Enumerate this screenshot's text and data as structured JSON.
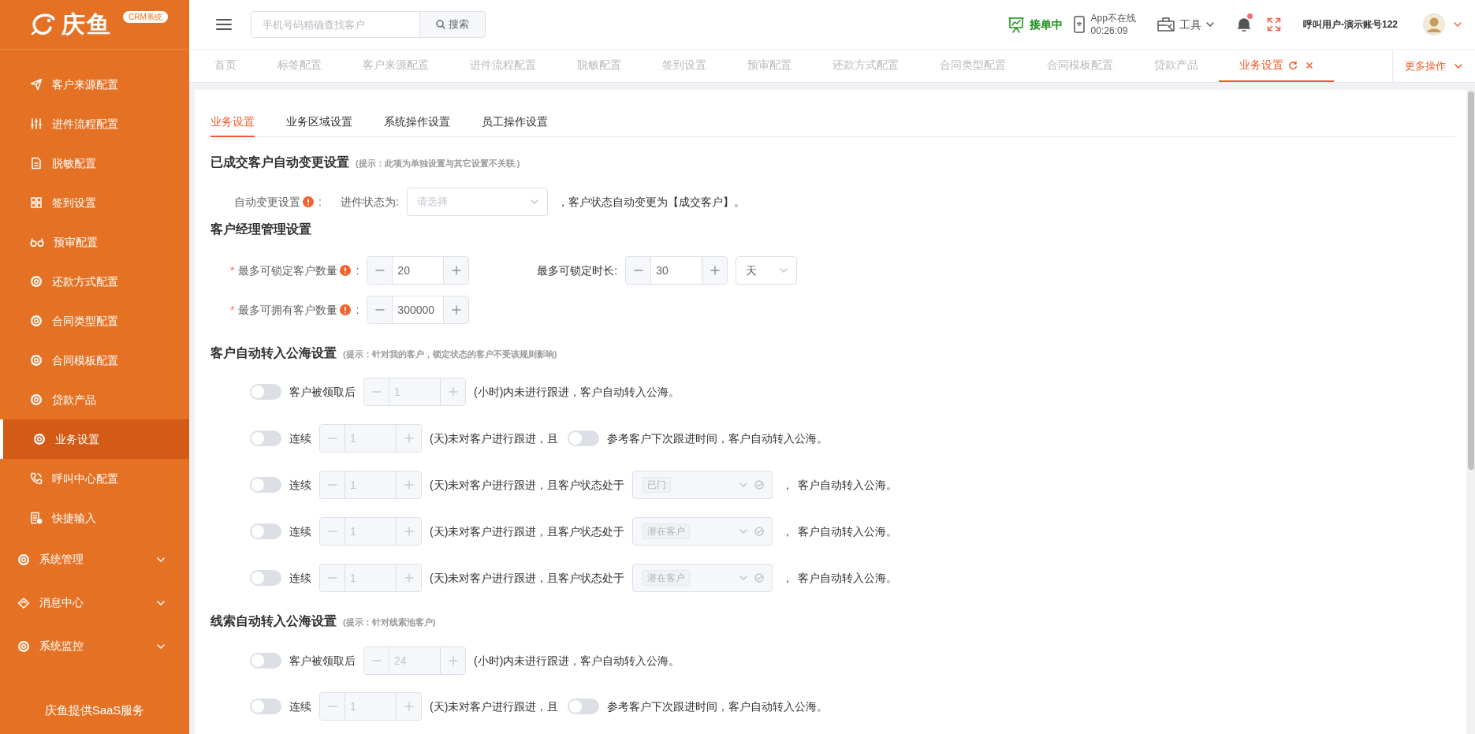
{
  "logo": {
    "name": "庆鱼",
    "badge": "CRM系统"
  },
  "sidebar": {
    "items": [
      {
        "label": "客户来源配置",
        "selected": false
      },
      {
        "label": "进件流程配置",
        "selected": false
      },
      {
        "label": "脱敏配置",
        "selected": false
      },
      {
        "label": "签到设置",
        "selected": false
      },
      {
        "label": "预审配置",
        "selected": false
      },
      {
        "label": "还款方式配置",
        "selected": false
      },
      {
        "label": "合同类型配置",
        "selected": false
      },
      {
        "label": "合同模板配置",
        "selected": false
      },
      {
        "label": "贷款产品",
        "selected": false
      },
      {
        "label": "业务设置",
        "selected": true
      },
      {
        "label": "呼叫中心配置",
        "selected": false
      },
      {
        "label": "快捷输入",
        "selected": false
      }
    ],
    "groups": [
      {
        "label": "系统管理",
        "expanded": false
      },
      {
        "label": "消息中心",
        "expanded": false
      },
      {
        "label": "系统监控",
        "expanded": false
      }
    ],
    "footer": "庆鱼提供SaaS服务"
  },
  "header": {
    "search": {
      "placeholder": "手机号码精确查找客户",
      "button": "搜索"
    },
    "order_status": "接单中",
    "app_status": {
      "label": "App不在线",
      "time": "00:26:09"
    },
    "tools": "工具",
    "notification_dot": true,
    "user": "呼叫用户-演示账号122"
  },
  "page_tabs": {
    "items": [
      {
        "label": "首页",
        "selected": false
      },
      {
        "label": "标签配置",
        "selected": false
      },
      {
        "label": "客户来源配置",
        "selected": false
      },
      {
        "label": "进件流程配置",
        "selected": false
      },
      {
        "label": "脱敏配置",
        "selected": false
      },
      {
        "label": "签到设置",
        "selected": false
      },
      {
        "label": "预审配置",
        "selected": false
      },
      {
        "label": "还款方式配置",
        "selected": false
      },
      {
        "label": "合同类型配置",
        "selected": false
      },
      {
        "label": "合同模板配置",
        "selected": false
      },
      {
        "label": "贷款产品",
        "selected": false
      },
      {
        "label": "业务设置",
        "selected": true
      }
    ],
    "more": "更多操作"
  },
  "sub_tabs": [
    {
      "label": "业务设置",
      "selected": true
    },
    {
      "label": "业务区域设置",
      "selected": false
    },
    {
      "label": "系统操作设置",
      "selected": false
    },
    {
      "label": "员工操作设置",
      "selected": false
    }
  ],
  "sections": [
    {
      "title": "已成交客户自动变更设置",
      "hint": "(提示：此项为单独设置与其它设置不关联.)",
      "kind": "form",
      "rows": [
        {
          "parts": [
            {
              "kind": "label",
              "text": "自动变更设置",
              "info": true,
              "colon": ":"
            },
            {
              "kind": "text",
              "text": "进件状态为:"
            },
            {
              "kind": "select",
              "placeholder": "请选择"
            },
            {
              "kind": "text",
              "text": "，客户状态自动变更为【成交客户】。"
            }
          ]
        }
      ]
    },
    {
      "title": "客户经理管理设置",
      "kind": "form",
      "rows": [
        {
          "parts": [
            {
              "kind": "label",
              "required_mark": "*",
              "text": "最多可锁定客户数量",
              "info": true,
              "colon": ":"
            },
            {
              "kind": "stepper",
              "value": "20",
              "disabled": false
            },
            {
              "kind": "text",
              "text": "最多可锁定时长:"
            },
            {
              "kind": "stepper",
              "value": "30",
              "disabled": false
            },
            {
              "kind": "select",
              "value": "天"
            }
          ]
        },
        {
          "parts": [
            {
              "kind": "label",
              "required_mark": "*",
              "text": "最多可拥有客户数量",
              "info": true,
              "colon": ":"
            },
            {
              "kind": "stepper",
              "value": "300000",
              "disabled": false
            }
          ]
        }
      ]
    },
    {
      "title": "客户自动转入公海设置",
      "hint": "(提示：针对我的客户，锁定状态的客户不受该规则影响)",
      "kind": "rules",
      "rows": [
        {
          "parts": [
            {
              "kind": "toggle",
              "on": false
            },
            {
              "kind": "text",
              "text": "客户被领取后"
            },
            {
              "kind": "stepper",
              "value": "1",
              "disabled": true
            },
            {
              "kind": "text",
              "text": "(小时)内未进行跟进，客户自动转入公海。"
            }
          ]
        },
        {
          "parts": [
            {
              "kind": "toggle",
              "on": false
            },
            {
              "kind": "text",
              "text": "连续"
            },
            {
              "kind": "stepper",
              "value": "1",
              "disabled": true
            },
            {
              "kind": "text",
              "text": "(天)未对客户进行跟进，且"
            },
            {
              "kind": "toggle",
              "on": false
            },
            {
              "kind": "text",
              "text": "参考客户下次跟进时间，客户自动转入公海。"
            }
          ]
        },
        {
          "parts": [
            {
              "kind": "toggle",
              "on": false
            },
            {
              "kind": "text",
              "text": "连续"
            },
            {
              "kind": "stepper",
              "value": "1",
              "disabled": true
            },
            {
              "kind": "text",
              "text": "(天)未对客户进行跟进，且客户状态处于"
            },
            {
              "kind": "select",
              "tag": "已门",
              "disabled": true
            },
            {
              "kind": "text",
              "text": "，"
            },
            {
              "kind": "text",
              "text": "客户自动转入公海。"
            }
          ]
        },
        {
          "parts": [
            {
              "kind": "toggle",
              "on": false
            },
            {
              "kind": "text",
              "text": "连续"
            },
            {
              "kind": "stepper",
              "value": "1",
              "disabled": true
            },
            {
              "kind": "text",
              "text": "(天)未对客户进行跟进，且客户状态处于"
            },
            {
              "kind": "select",
              "tag": "潜在客户",
              "disabled": true
            },
            {
              "kind": "text",
              "text": "，"
            },
            {
              "kind": "text",
              "text": "客户自动转入公海。"
            }
          ]
        },
        {
          "parts": [
            {
              "kind": "toggle",
              "on": false
            },
            {
              "kind": "text",
              "text": "连续"
            },
            {
              "kind": "stepper",
              "value": "1",
              "disabled": true
            },
            {
              "kind": "text",
              "text": "(天)未对客户进行跟进，且客户状态处于"
            },
            {
              "kind": "select",
              "tag": "潜在客户",
              "disabled": true
            },
            {
              "kind": "text",
              "text": "，"
            },
            {
              "kind": "text",
              "text": "客户自动转入公海。"
            }
          ]
        }
      ]
    },
    {
      "title": "线索自动转入公海设置",
      "hint": "(提示：针对线索池客户)",
      "kind": "rules",
      "rows": [
        {
          "parts": [
            {
              "kind": "toggle",
              "on": false
            },
            {
              "kind": "text",
              "text": "客户被领取后"
            },
            {
              "kind": "stepper",
              "value": "24",
              "disabled": true
            },
            {
              "kind": "text",
              "text": "(小时)内未进行跟进，客户自动转入公海。"
            }
          ]
        },
        {
          "parts": [
            {
              "kind": "toggle",
              "on": false
            },
            {
              "kind": "text",
              "text": "连续"
            },
            {
              "kind": "stepper",
              "value": "1",
              "disabled": true
            },
            {
              "kind": "text",
              "text": "(天)未对客户进行跟进，且"
            },
            {
              "kind": "toggle",
              "on": false
            },
            {
              "kind": "text",
              "text": "参考客户下次跟进时间，客户自动转入公海。"
            }
          ]
        }
      ]
    }
  ]
}
